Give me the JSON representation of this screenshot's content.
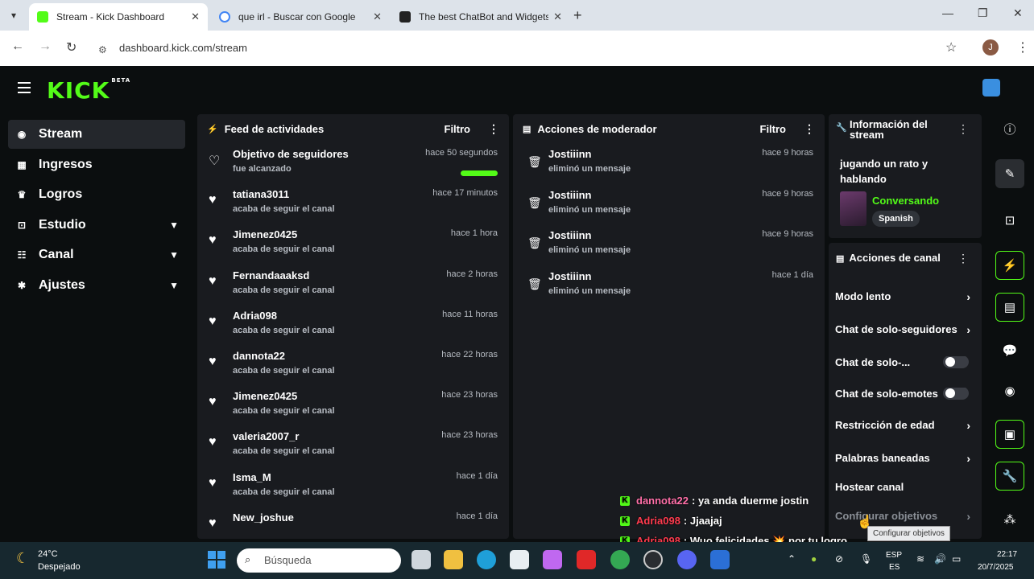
{
  "browser": {
    "tabs": [
      {
        "title": "Stream - Kick Dashboard",
        "active": true
      },
      {
        "title": "que irl - Buscar con Google",
        "active": false
      },
      {
        "title": "The best ChatBot and Widgets",
        "active": false
      }
    ],
    "url": "dashboard.kick.com/stream",
    "profile_initial": "J"
  },
  "app": {
    "logo": "KICK",
    "logo_sup": "BETA"
  },
  "sidebar": {
    "items": [
      {
        "label": "Stream",
        "icon": "broadcast-icon"
      },
      {
        "label": "Ingresos",
        "icon": "wallet-icon"
      },
      {
        "label": "Logros",
        "icon": "trophy-icon"
      },
      {
        "label": "Estudio",
        "icon": "studio-icon"
      },
      {
        "label": "Canal",
        "icon": "channel-icon"
      },
      {
        "label": "Ajustes",
        "icon": "gear-icon"
      }
    ]
  },
  "feed": {
    "title": "Feed de actividades",
    "filter": "Filtro",
    "rows": [
      {
        "name": "Objetivo de seguidores",
        "sub": "fue alcanzado",
        "time": "hace 50 segundos",
        "progress": 1.0
      },
      {
        "name": "tatiana3011",
        "sub": "acaba de seguir el canal",
        "time": "hace 17 minutos"
      },
      {
        "name": "Jimenez0425",
        "sub": "acaba de seguir el canal",
        "time": "hace 1 hora"
      },
      {
        "name": "Fernandaaaksd",
        "sub": "acaba de seguir el canal",
        "time": "hace 2 horas"
      },
      {
        "name": "Adria098",
        "sub": "acaba de seguir el canal",
        "time": "hace 11 horas"
      },
      {
        "name": "dannota22",
        "sub": "acaba de seguir el canal",
        "time": "hace 22 horas"
      },
      {
        "name": "Jimenez0425",
        "sub": "acaba de seguir el canal",
        "time": "hace 23 horas"
      },
      {
        "name": "valeria2007_r",
        "sub": "acaba de seguir el canal",
        "time": "hace 23 horas"
      },
      {
        "name": "Isma_M",
        "sub": "acaba de seguir el canal",
        "time": "hace 1 día"
      },
      {
        "name": "New_joshue",
        "sub": "",
        "time": "hace 1 día"
      }
    ]
  },
  "moderation": {
    "title": "Acciones de moderador",
    "filter": "Filtro",
    "rows": [
      {
        "name": "Jostiiinn",
        "sub": "eliminó un mensaje",
        "time": "hace 9 horas"
      },
      {
        "name": "Jostiiinn",
        "sub": "eliminó un mensaje",
        "time": "hace 9 horas"
      },
      {
        "name": "Jostiiinn",
        "sub": "eliminó un mensaje",
        "time": "hace 9 horas"
      },
      {
        "name": "Jostiiinn",
        "sub": "eliminó un mensaje",
        "time": "hace 1 día"
      }
    ]
  },
  "stream_info": {
    "title": "Información del stream",
    "stream_title": "jugando un rato y hablando",
    "category": "Conversando",
    "language": "Spanish"
  },
  "channel_actions": {
    "title": "Acciones de canal",
    "items": [
      {
        "label": "Modo lento",
        "control": "chevron"
      },
      {
        "label": "Chat de solo-seguidores",
        "control": "chevron"
      },
      {
        "label": "Chat de solo-...",
        "control": "toggle",
        "on": false
      },
      {
        "label": "Chat de solo-emotes",
        "control": "toggle",
        "on": false
      },
      {
        "label": "Restricción de edad",
        "control": "chevron"
      },
      {
        "label": "Palabras baneadas",
        "control": "chevron"
      },
      {
        "label": "Hostear canal",
        "control": "none"
      },
      {
        "label": "Configurar objetivos",
        "control": "chevron"
      }
    ]
  },
  "chat_overlay": [
    {
      "user": "dannota22",
      "text": ": ya anda duerme jostin",
      "color": "#ff6fa8"
    },
    {
      "user": "Adria098",
      "text": ": Jjaajaj",
      "color": "#ff3b4e"
    },
    {
      "user": "Adria098",
      "text": ": Wuo felicidades 💥 por tu logro",
      "color": "#ff3b4e"
    }
  ],
  "tooltip": "Configurar objetivos",
  "taskbar": {
    "temp": "24°C",
    "weather": "Despejado",
    "search_placeholder": "Búsqueda",
    "lang_top": "ESP",
    "lang_bottom": "ES",
    "time": "22:17",
    "date": "20/7/2025"
  },
  "colors": {
    "accent": "#53fc18",
    "panel": "#191b1f",
    "background": "#0b0e0f"
  }
}
